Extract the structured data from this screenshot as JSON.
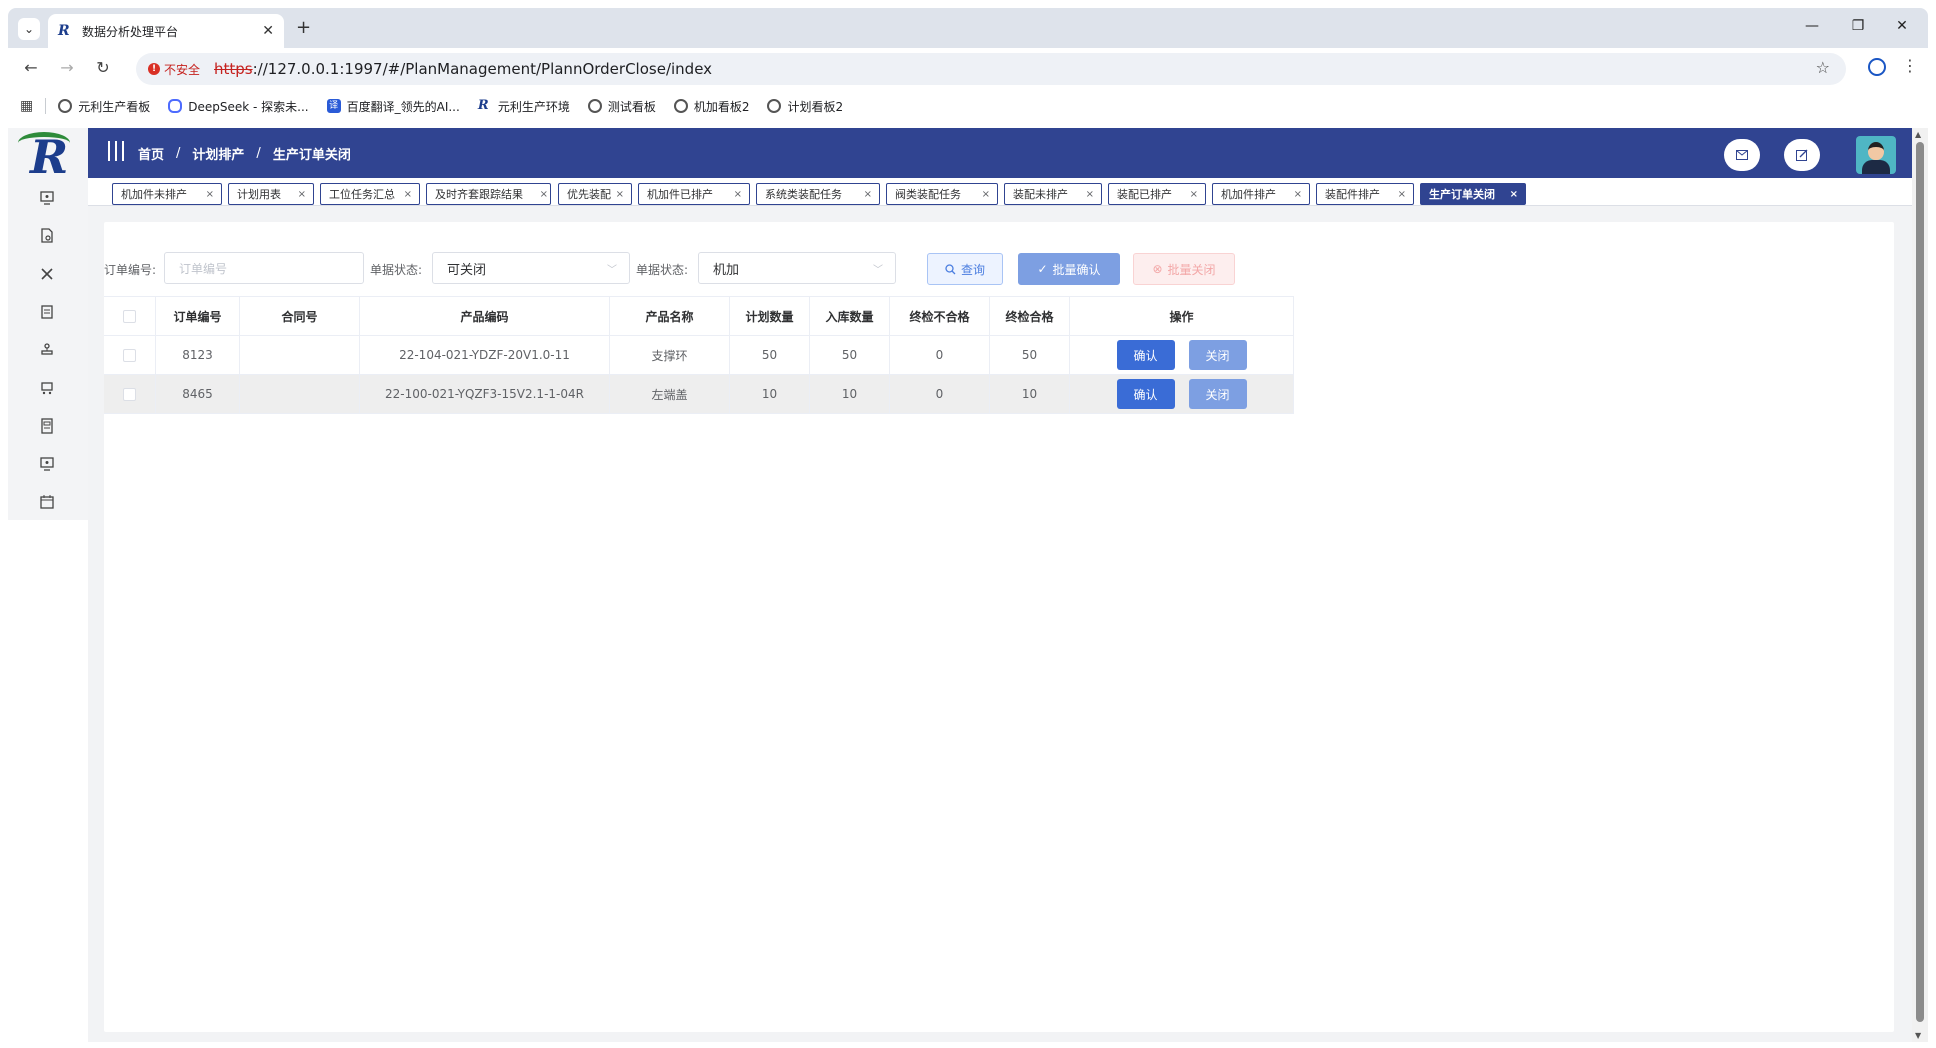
{
  "browser": {
    "tab_title": "数据分析处理平台",
    "tab_favicon": "R",
    "new_tab_label": "+",
    "security_label": "不安全",
    "url_protocol": "https",
    "url_rest": "://127.0.0.1:1997/#/PlanManagement/PlannOrderClose/index",
    "bookmarks": [
      {
        "label": "元利生产看板",
        "icon": "globe-icon"
      },
      {
        "label": "DeepSeek - 探索未...",
        "icon": "deepseek-icon"
      },
      {
        "label": "百度翻译_领先的AI...",
        "icon": "baidu-translate-icon"
      },
      {
        "label": "元利生产环境",
        "icon": "yuanli-icon"
      },
      {
        "label": "测试看板",
        "icon": "globe-icon"
      },
      {
        "label": "机加看板2",
        "icon": "globe-icon"
      },
      {
        "label": "计划看板2",
        "icon": "globe-icon"
      }
    ]
  },
  "header": {
    "breadcrumb": [
      "首页",
      "计划排产",
      "生产订单关闭"
    ],
    "breadcrumb_sep": "/"
  },
  "tags": [
    {
      "label": "机加件未排产",
      "active": false
    },
    {
      "label": "计划用表",
      "active": false
    },
    {
      "label": "工位任务汇总",
      "active": false
    },
    {
      "label": "及时齐套跟踪结果",
      "active": false
    },
    {
      "label": "优先装配",
      "active": false
    },
    {
      "label": "机加件已排产",
      "active": false
    },
    {
      "label": "系统类装配任务",
      "active": false
    },
    {
      "label": "阀类装配任务",
      "active": false
    },
    {
      "label": "装配未排产",
      "active": false
    },
    {
      "label": "装配已排产",
      "active": false
    },
    {
      "label": "机加件排产",
      "active": false
    },
    {
      "label": "装配件排产",
      "active": false
    },
    {
      "label": "生产订单关闭",
      "active": true
    }
  ],
  "filters": {
    "order_no_label": "订单编号:",
    "order_no_placeholder": "订单编号",
    "status_label_1": "单据状态:",
    "status_value_1": "可关闭",
    "status_label_2": "单据状态:",
    "status_value_2": "机加",
    "query_label": "查询",
    "batch_confirm_label": "批量确认",
    "batch_close_label": "批量关闭"
  },
  "table": {
    "columns": [
      "订单编号",
      "合同号",
      "产品编码",
      "产品名称",
      "计划数量",
      "入库数量",
      "终检不合格",
      "终检合格",
      "操作"
    ],
    "rows": [
      {
        "order_no": "8123",
        "contract": "",
        "product_code": "22-104-021-YDZF-20V1.0-11",
        "product_name": "支撑环",
        "plan_qty": "50",
        "in_qty": "50",
        "fail_qty": "0",
        "pass_qty": "50"
      },
      {
        "order_no": "8465",
        "contract": "",
        "product_code": "22-100-021-YQZF3-15V2.1-1-04R",
        "product_name": "左端盖",
        "plan_qty": "10",
        "in_qty": "10",
        "fail_qty": "0",
        "pass_qty": "10"
      }
    ],
    "confirm_label": "确认",
    "close_label": "关闭"
  },
  "colors": {
    "header_bg": "#304491",
    "primary_btn": "#3a6cd6",
    "secondary_btn": "#7d9fe2",
    "alt_row": "#eeeeee"
  }
}
